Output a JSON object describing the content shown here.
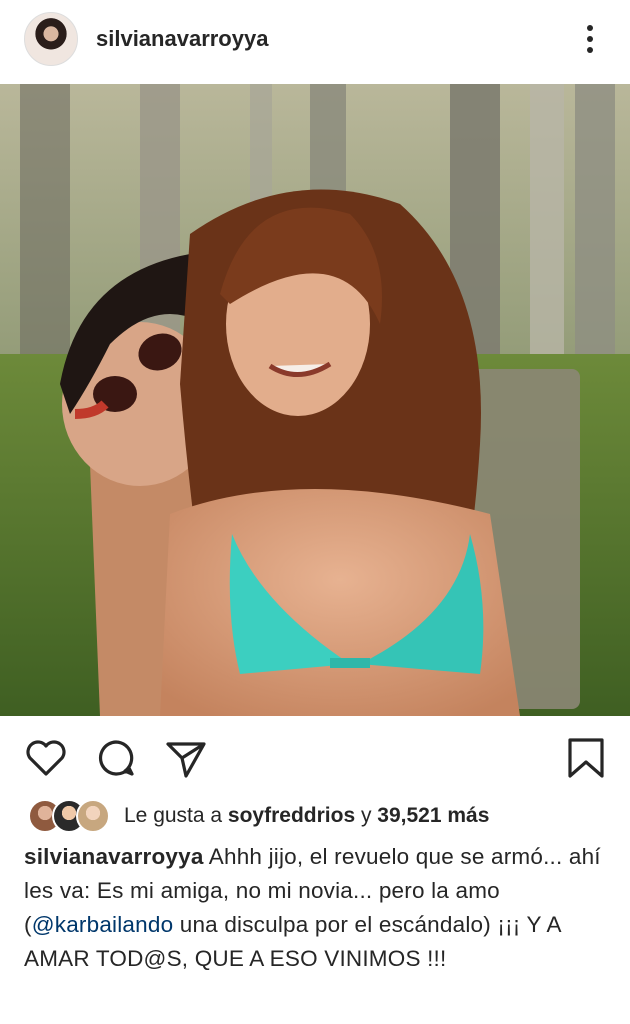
{
  "post": {
    "username": "silvianavarroyya",
    "likes": {
      "prefix": "Le gusta a ",
      "liked_by": "soyfreddrios",
      "connector": " y ",
      "count_text": "39,521 más"
    },
    "caption": {
      "username": "silvianavarroyya",
      "text_part1": " Ahhh jijo, el revuelo que se armó... ahí les va: Es mi amiga, no mi novia... pero la amo (",
      "mention": "@karbailando",
      "text_part2": " una disculpa por el escándalo) ¡¡¡ Y A AMAR TOD@S, QUE A ESO VINIMOS !!!"
    }
  },
  "icons": {
    "more": "more-options-icon",
    "like": "heart-icon",
    "comment": "comment-icon",
    "share": "share-icon",
    "save": "bookmark-icon"
  },
  "colors": {
    "text": "#262626",
    "mention": "#00376b",
    "swimsuit": "#3ccfc0"
  }
}
